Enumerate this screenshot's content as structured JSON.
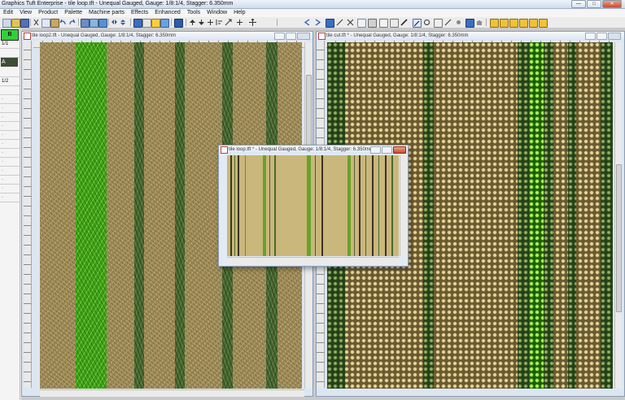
{
  "app": {
    "title": "Graphics Tuft Enterprise - tile loop.tft - Unequal Gauged, Gauge: 1/8:1/4, Stagger: 6.350mm"
  },
  "menu": [
    "Edit",
    "View",
    "Product",
    "Palette",
    "Machine parts",
    "Effects",
    "Enhanced",
    "Tools",
    "Window",
    "Help"
  ],
  "palette_panel": {
    "selected_label": "B",
    "material_label": "A",
    "rows": [
      "1/1",
      "1/2",
      "",
      "",
      "",
      "",
      "",
      "",
      "",
      "",
      "",
      ""
    ]
  },
  "windows": {
    "left": {
      "title": "tile loop2.tft - Unequal Gauged, Gauge: 1/8:1/4, Stagger: 6.350mm"
    },
    "right": {
      "title": "tile cut.tft * - Unequal Gauged, Gauge: 1/8:1/4, Stagger: 6.350mm"
    },
    "preview": {
      "title": "tile loop.tft * - Unequal Gauged, Gauge: 1/8:1/4, Stagger: 6.350mm"
    }
  },
  "colors": {
    "beige_yarn": "#a4915c",
    "bright_green_yarn": "#3fa418",
    "dark_green_yarn": "#4c6a33",
    "green_selected": "#31d13a"
  },
  "icons": {
    "toolbar": [
      "new-icon",
      "open-icon",
      "save-icon",
      "print-icon",
      "cut-icon",
      "copy-icon",
      "paste-icon",
      "undo-icon",
      "redo-icon",
      "zoom-in-icon",
      "zoom-out-icon",
      "move-icon",
      "rotate-icon",
      "select-icon",
      "pencil-icon",
      "fill-icon",
      "eyedropper-icon",
      "palette-icon"
    ]
  }
}
